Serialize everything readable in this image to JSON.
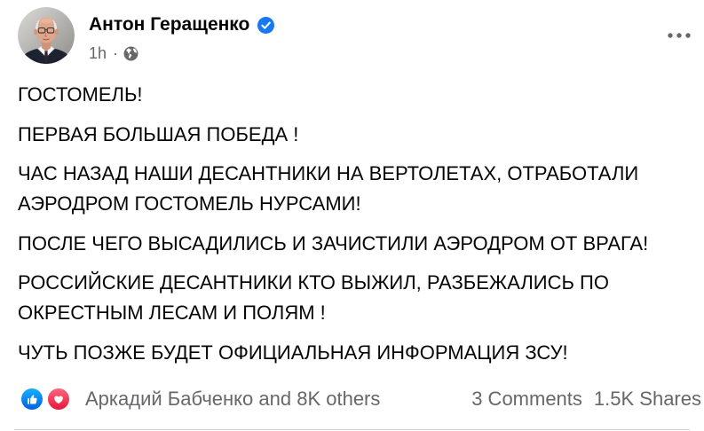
{
  "colors": {
    "text": "#050505",
    "secondary_text": "#65676b",
    "verified_blue": "#1877f2",
    "divider": "#ced0d4",
    "like_gradient": [
      "#18afff",
      "#0062df"
    ],
    "love_gradient": [
      "#ff6680",
      "#e61739"
    ]
  },
  "post": {
    "author": {
      "name": "Антон Геращенко",
      "verified_icon": "verified-badge-icon"
    },
    "meta": {
      "time": "1h",
      "separator": "·",
      "audience_icon": "globe-icon"
    },
    "more_options_icon": "more-horizontal-icon",
    "paragraphs": [
      [
        "ГОСТОМЕЛЬ!"
      ],
      [
        "ПЕРВАЯ БОЛЬШАЯ ПОБЕДА !"
      ],
      [
        "ЧАС НАЗАД НАШИ ДЕСАНТНИКИ НА ВЕРТОЛЕТАХ, ОТРАБОТАЛИ",
        "АЭРОДРОМ ГОСТОМЕЛЬ НУРСАМИ!"
      ],
      [
        "ПОСЛЕ ЧЕГО ВЫСАДИЛИСЬ И ЗАЧИСТИЛИ АЭРОДРОМ ОТ ВРАГА!"
      ],
      [
        "РОССИЙСКИЕ ДЕСАНТНИКИ КТО ВЫЖИЛ, РАЗБЕЖАЛИСЬ ПО",
        "ОКРЕСТНЫМ ЛЕСАМ И ПОЛЯМ !"
      ],
      [
        "ЧУТЬ ПОЗЖЕ БУДЕТ ОФИЦИАЛЬНАЯ ИНФОРМАЦИЯ ЗСУ!"
      ]
    ],
    "reactions": {
      "icons": [
        "like-icon",
        "love-icon"
      ],
      "summary": "Аркадий Бабченко and 8K others"
    },
    "engagement": {
      "comments": "3 Comments",
      "shares": "1.5K Shares"
    }
  }
}
